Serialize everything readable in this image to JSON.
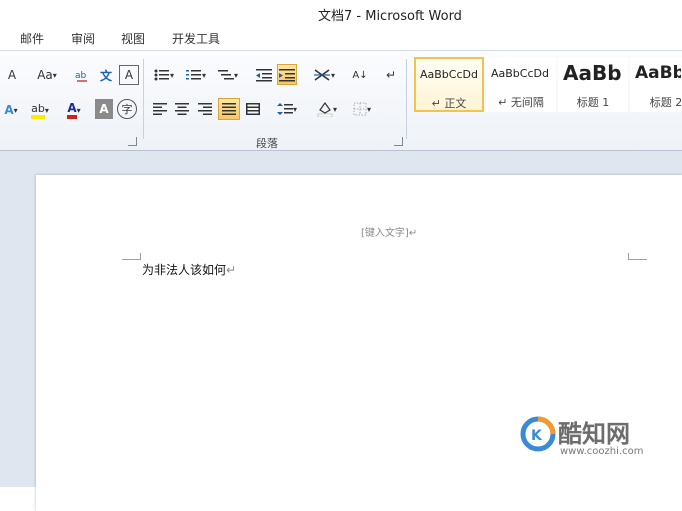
{
  "window": {
    "title": "文档7 - Microsoft Word"
  },
  "tabs": [
    "邮件",
    "审阅",
    "视图",
    "开发工具"
  ],
  "ribbon": {
    "font_group": {
      "font_size_button": "A",
      "change_case_button": "Aa",
      "phonetic_guide_button": "文",
      "enclose_char_button": "A",
      "text_effects_button": "A",
      "highlight_button": "ab",
      "font_color_button": "A",
      "char_shading_button": "A",
      "enclose_char_circle_button": "字"
    },
    "paragraph_group": {
      "label": "段落",
      "sort_button": "A↓",
      "show_marks_button": "↵"
    },
    "styles_group": {
      "items": [
        {
          "sample": "AaBbCcDd",
          "name": "正文",
          "selected": true
        },
        {
          "sample": "AaBbCcDd",
          "name": "无间隔",
          "selected": false
        },
        {
          "sample": "AaBb",
          "name": "标题 1",
          "selected": false
        },
        {
          "sample": "AaBb",
          "name": "标题 2",
          "selected": false
        }
      ]
    }
  },
  "document": {
    "header_placeholder": "[键入文字]",
    "body_text": "为非法人该如何"
  },
  "watermark": {
    "title": "酷知网",
    "url": "www.coozhi.com"
  },
  "colors": {
    "selected_tile_border": "#f1c44f",
    "active_button_bg": "#f8c75f",
    "ribbon_bg": "#eef2f7",
    "doc_bg": "#dfe6ef"
  },
  "icons": [
    "bullets-icon",
    "numbering-icon",
    "multilevel-list-icon",
    "decrease-indent-icon",
    "increase-indent-icon",
    "chinese-layout-icon",
    "sort-icon",
    "show-marks-icon",
    "align-left-icon",
    "center-icon",
    "align-right-icon",
    "justify-icon",
    "distributed-icon",
    "line-spacing-icon",
    "shading-icon",
    "borders-icon",
    "text-effects-icon",
    "highlight-icon",
    "font-color-icon"
  ]
}
